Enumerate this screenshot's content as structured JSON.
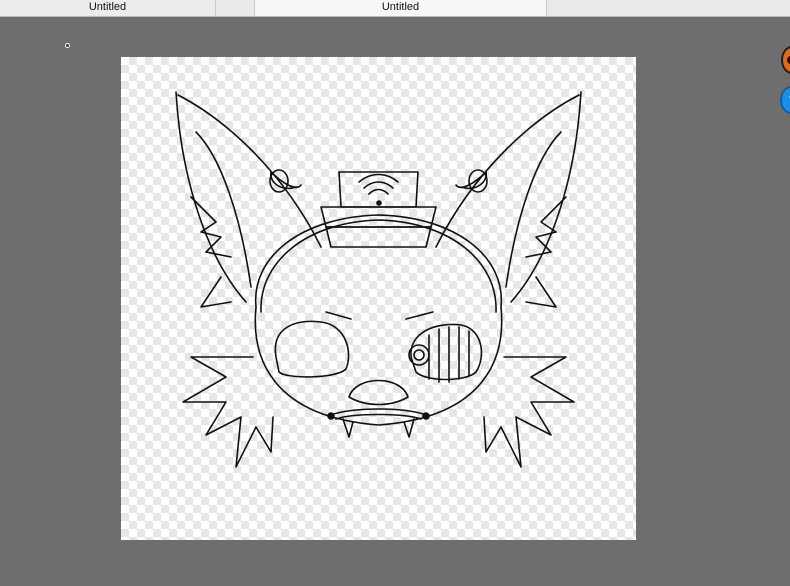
{
  "tabs": [
    {
      "label": "Untitled"
    },
    {
      "label": "Untitled"
    }
  ],
  "colors": {
    "workspace": "#6e6e6e",
    "tab_bar": "#e9e9e9",
    "sketch_stroke": "#111111",
    "side_icon_orange": "#e06a18",
    "side_icon_blue": "#1b8fe6"
  },
  "icons": {
    "side_top": "orange-app-icon",
    "side_bottom": "blue-app-icon"
  }
}
